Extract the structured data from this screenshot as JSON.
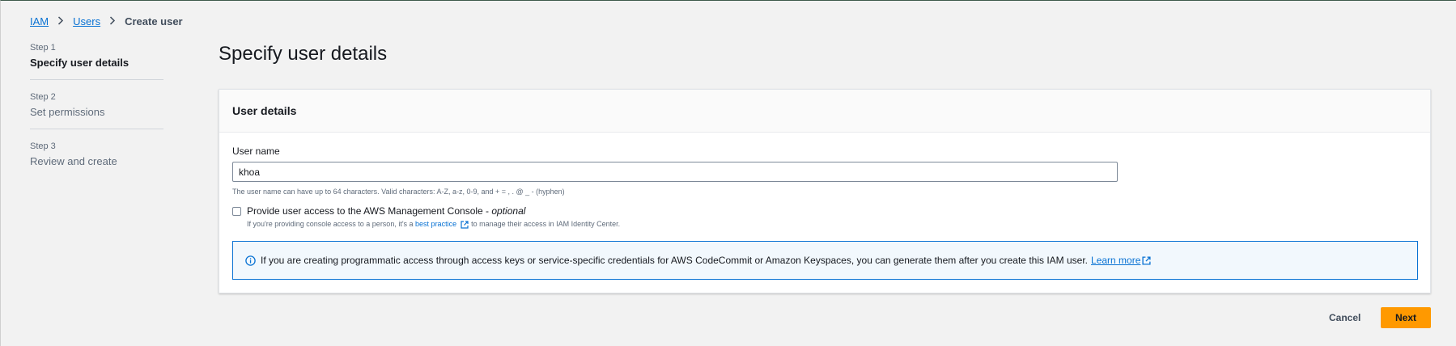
{
  "breadcrumb": {
    "items": [
      "IAM",
      "Users"
    ],
    "current": "Create user"
  },
  "steps": [
    {
      "num": "Step 1",
      "label": "Specify user details"
    },
    {
      "num": "Step 2",
      "label": "Set permissions"
    },
    {
      "num": "Step 3",
      "label": "Review and create"
    }
  ],
  "page": {
    "title": "Specify user details"
  },
  "user_details": {
    "title": "User details",
    "username_label": "User name",
    "username_value": "khoa",
    "username_constraint": "The user name can have up to 64 characters. Valid characters: A-Z, a-z, 0-9, and + = , . @ _ - (hyphen)",
    "console_access_label": "Provide user access to the AWS Management Console - ",
    "console_access_optional": "optional",
    "console_access_desc_prefix": "If you're providing console access to a person, it's a ",
    "console_access_desc_link": "best practice",
    "console_access_desc_suffix": " to manage their access in IAM Identity Center.",
    "console_access_checked": false
  },
  "info_alert": {
    "text": "If you are creating programmatic access through access keys or service-specific credentials for AWS CodeCommit or Amazon Keyspaces, you can generate them after you create this IAM user.",
    "link": "Learn more"
  },
  "actions": {
    "cancel": "Cancel",
    "next": "Next"
  },
  "colors": {
    "accent": "#0972d3",
    "primary_button": "#ff9900"
  }
}
